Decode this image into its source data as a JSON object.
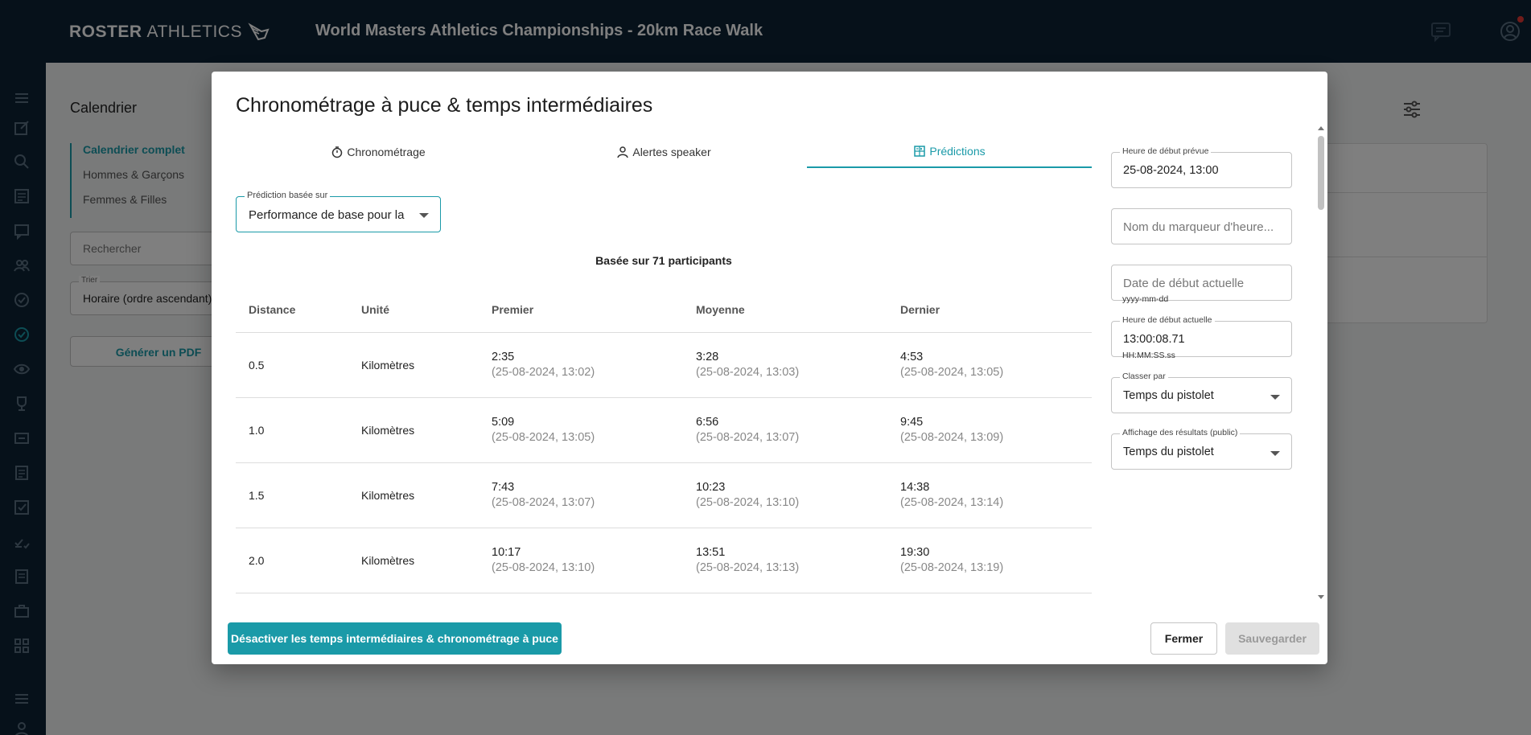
{
  "header": {
    "brand_bold": "ROSTER",
    "brand_light": "ATHLETICS",
    "event_title": "World Masters Athletics Championships - 20km Race Walk"
  },
  "background_page": {
    "title": "Calendrier",
    "nav": [
      "Calendrier complet",
      "Hommes & Garçons",
      "Femmes & Filles"
    ],
    "search_placeholder": "Rechercher",
    "sort_label": "Trier",
    "sort_value": "Horaire (ordre ascendant)",
    "pdf_button": "Générer un PDF"
  },
  "modal": {
    "title": "Chronométrage à puce & temps intermédiaires",
    "tabs": [
      {
        "label": "Chronométrage",
        "icon": "stopwatch-icon",
        "active": false
      },
      {
        "label": "Alertes speaker",
        "icon": "person-icon",
        "active": true
      },
      {
        "label": "Prédictions",
        "icon": "calculator-icon",
        "active": true
      }
    ],
    "prediction_select": {
      "label": "Prédiction basée sur",
      "value": "Performance de base pour la"
    },
    "based_on": "Basée sur 71 participants",
    "table": {
      "columns": [
        "Distance",
        "Unité",
        "Premier",
        "Moyenne",
        "Dernier"
      ],
      "rows": [
        {
          "distance": "0.5",
          "unit": "Kilomètres",
          "first": "2:35",
          "first_ts": "(25-08-2024, 13:02)",
          "avg": "3:28",
          "avg_ts": "(25-08-2024, 13:03)",
          "last": "4:53",
          "last_ts": "(25-08-2024, 13:05)"
        },
        {
          "distance": "1.0",
          "unit": "Kilomètres",
          "first": "5:09",
          "first_ts": "(25-08-2024, 13:05)",
          "avg": "6:56",
          "avg_ts": "(25-08-2024, 13:07)",
          "last": "9:45",
          "last_ts": "(25-08-2024, 13:09)"
        },
        {
          "distance": "1.5",
          "unit": "Kilomètres",
          "first": "7:43",
          "first_ts": "(25-08-2024, 13:07)",
          "avg": "10:23",
          "avg_ts": "(25-08-2024, 13:10)",
          "last": "14:38",
          "last_ts": "(25-08-2024, 13:14)"
        },
        {
          "distance": "2.0",
          "unit": "Kilomètres",
          "first": "10:17",
          "first_ts": "(25-08-2024, 13:10)",
          "avg": "13:51",
          "avg_ts": "(25-08-2024, 13:13)",
          "last": "19:30",
          "last_ts": "(25-08-2024, 13:19)"
        }
      ]
    },
    "right_panel": {
      "planned_start_label": "Heure de début prévue",
      "planned_start_value": "25-08-2024, 13:00",
      "marker_placeholder": "Nom du marqueur d'heure...",
      "actual_date_placeholder": "Date de début actuelle",
      "actual_date_helper": "yyyy-mm-dd",
      "actual_time_label": "Heure de début actuelle",
      "actual_time_value": "13:00:08.71",
      "actual_time_helper": "HH:MM:SS.ss",
      "rank_by_label": "Classer par",
      "rank_by_value": "Temps du pistolet",
      "results_display_label": "Affichage des résultats (public)",
      "results_display_value": "Temps du pistolet"
    },
    "buttons": {
      "disable": "Désactiver les temps intermédiaires & chronométrage à puce",
      "close": "Fermer",
      "save": "Sauvegarder"
    }
  },
  "colors": {
    "accent": "#1a9aa8",
    "header_bg": "#0d2235"
  }
}
